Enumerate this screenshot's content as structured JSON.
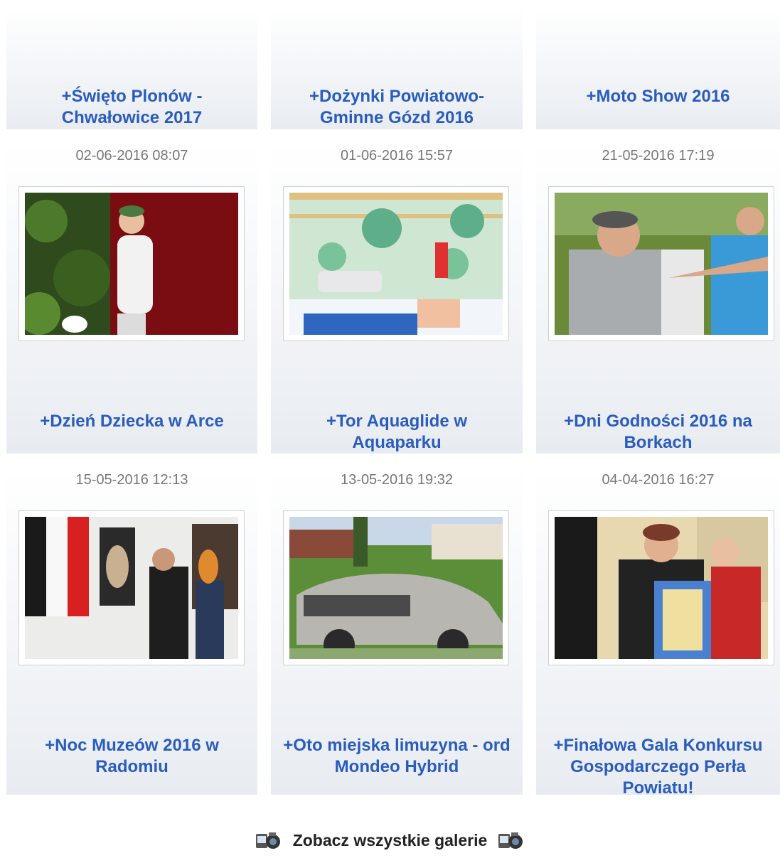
{
  "top_row": [
    {
      "title": "+Święto Plonów - Chwałowice 2017"
    },
    {
      "title": "+Dożynki Powiatowo-Gminne Gózd 2016"
    },
    {
      "title": "+Moto Show 2016"
    }
  ],
  "galleries": [
    {
      "date": "02-06-2016 08:07",
      "title": "+Dzień Dziecka w Arce",
      "photo_icon": "photo-boy-bubbles"
    },
    {
      "date": "01-06-2016 15:57",
      "title": "+Tor Aquaglide w Aquaparku",
      "photo_icon": "photo-aquapark"
    },
    {
      "date": "21-05-2016 17:19",
      "title": "+Dni Godności 2016 na Borkach",
      "photo_icon": "photo-crowd"
    },
    {
      "date": "15-05-2016 12:13",
      "title": "+Noc Muzeów 2016 w Radomiu",
      "photo_icon": "photo-museum"
    },
    {
      "date": "13-05-2016 19:32",
      "title": "+Oto miejska limuzyna - ord Mondeo Hybrid",
      "photo_icon": "photo-car"
    },
    {
      "date": "04-04-2016 16:27",
      "title": "+Finałowa Gala Konkursu Gospodarczego Perła Powiatu!",
      "photo_icon": "photo-award"
    }
  ],
  "footer": {
    "label": "Zobacz wszystkie galerie",
    "icon": "camera-icon"
  },
  "colors": {
    "link": "#2a5cbf",
    "date": "#777777"
  }
}
